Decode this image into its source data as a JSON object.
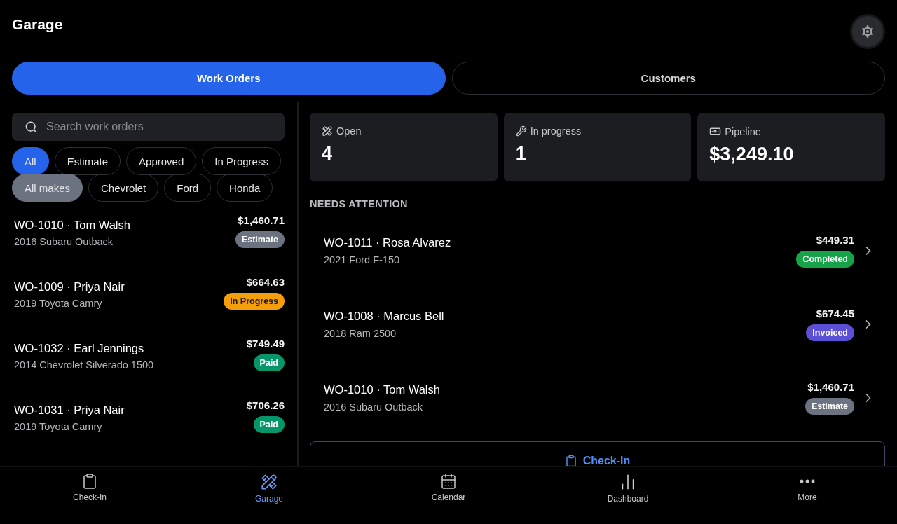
{
  "app_bar": {
    "title": "Garage"
  },
  "tabs": [
    {
      "label": "Work Orders",
      "selected": true
    },
    {
      "label": "Customers",
      "selected": false
    }
  ],
  "search": {
    "placeholder": "Search work orders"
  },
  "status_filters": [
    {
      "label": "All",
      "selected": true
    },
    {
      "label": "Estimate",
      "selected": false
    },
    {
      "label": "Approved",
      "selected": false
    },
    {
      "label": "In Progress",
      "selected": false
    }
  ],
  "make_filters": [
    {
      "label": "All makes",
      "selected": true
    },
    {
      "label": "Chevrolet",
      "selected": false
    },
    {
      "label": "Ford",
      "selected": false
    },
    {
      "label": "Honda",
      "selected": false
    }
  ],
  "work_orders": [
    {
      "title": "WO-1010 · Tom Walsh",
      "vehicle": "2016 Subaru Outback",
      "amount": "$1,460.71",
      "status": "Estimate",
      "color": "#6b7280"
    },
    {
      "title": "WO-1009 · Priya Nair",
      "vehicle": "2019 Toyota Camry",
      "amount": "$664.63",
      "status": "In Progress",
      "color": "#f59e0b"
    },
    {
      "title": "WO-1032 · Earl Jennings",
      "vehicle": "2014 Chevrolet Silverado 1500",
      "amount": "$749.49",
      "status": "Paid",
      "color": "#059669"
    },
    {
      "title": "WO-1031 · Priya Nair",
      "vehicle": "2019 Toyota Camry",
      "amount": "$706.26",
      "status": "Paid",
      "color": "#059669"
    }
  ],
  "stats": [
    {
      "kind": "open",
      "label": "Open",
      "value": "4"
    },
    {
      "kind": "progress",
      "label": "In progress",
      "value": "1"
    },
    {
      "kind": "pipeline",
      "label": "Pipeline",
      "value": "$3,249.10"
    }
  ],
  "needs_attention": {
    "heading": "NEEDS ATTENTION",
    "items": [
      {
        "title": "WO-1011 · Rosa Alvarez",
        "vehicle": "2021 Ford F-150",
        "amount": "$449.31",
        "status": "Completed",
        "color": "#16a34a"
      },
      {
        "title": "WO-1008 · Marcus Bell",
        "vehicle": "2018 Ram 2500",
        "amount": "$674.45",
        "status": "Invoiced",
        "color": "#5b4fd6"
      },
      {
        "title": "WO-1010 · Tom Walsh",
        "vehicle": "2016 Subaru Outback",
        "amount": "$1,460.71",
        "status": "Estimate",
        "color": "#6b7280"
      }
    ]
  },
  "check_in_button": {
    "label": "Check-In"
  },
  "bottom_nav": [
    {
      "kind": "checkin",
      "label": "Check-In",
      "selected": false
    },
    {
      "kind": "garage",
      "label": "Garage",
      "selected": true
    },
    {
      "kind": "calendar",
      "label": "Calendar",
      "selected": false
    },
    {
      "kind": "dashboard",
      "label": "Dashboard",
      "selected": false
    },
    {
      "kind": "more",
      "label": "More",
      "selected": false
    }
  ]
}
